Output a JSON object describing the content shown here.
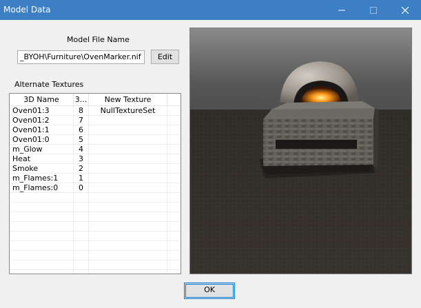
{
  "window": {
    "title": "Model Data"
  },
  "model_file": {
    "label": "Model File Name",
    "value": "_BYOH\\Furniture\\OvenMarker.nif",
    "edit_label": "Edit"
  },
  "textures": {
    "section_label": "Alternate Textures",
    "columns": [
      "3D Name",
      "3...",
      "New Texture"
    ],
    "rows": [
      {
        "name": "Oven01:3",
        "index": "8",
        "texture": "NullTextureSet"
      },
      {
        "name": "Oven01:2",
        "index": "7",
        "texture": ""
      },
      {
        "name": "Oven01:1",
        "index": "6",
        "texture": ""
      },
      {
        "name": "Oven01:0",
        "index": "5",
        "texture": ""
      },
      {
        "name": "m_Glow",
        "index": "4",
        "texture": ""
      },
      {
        "name": "Heat",
        "index": "3",
        "texture": ""
      },
      {
        "name": "Smoke",
        "index": "2",
        "texture": ""
      },
      {
        "name": "m_Flames:1",
        "index": "1",
        "texture": ""
      },
      {
        "name": "m_Flames:0",
        "index": "0",
        "texture": ""
      }
    ]
  },
  "buttons": {
    "ok_label": "OK"
  },
  "colors": {
    "titlebar": "#3c7fc4",
    "accent": "#0078d7"
  }
}
